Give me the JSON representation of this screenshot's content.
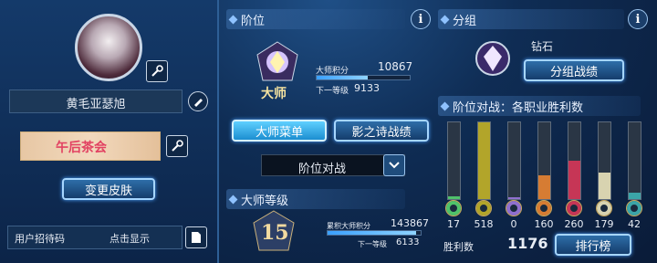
{
  "profile": {
    "name": "黄毛亚瑟旭",
    "change_skin": "变更皮肤",
    "invite_label": "用户招待码",
    "invite_action": "点击显示",
    "banner_text": "午后茶会"
  },
  "rank": {
    "header": "阶位",
    "rank_name": "大师",
    "points_label": "大师积分",
    "points": "10867",
    "next_label": "下一等级",
    "next_value": "9133",
    "progress": 0.55,
    "btn_master": "大师菜单",
    "btn_shadow": "影之诗战绩",
    "dropdown": "阶位对战"
  },
  "master_level": {
    "header": "大师等级",
    "level": "15",
    "points_label": "累积大师积分",
    "points": "143867",
    "next_label": "下一等级",
    "next_value": "6133",
    "progress": 0.95
  },
  "group": {
    "header": "分组",
    "name": "钻石",
    "btn": "分组战绩"
  },
  "class_wins": {
    "header": "阶位对战：各职业胜利数",
    "counts": [
      "17",
      "518",
      "0",
      "160",
      "260",
      "179",
      "42"
    ],
    "fills": [
      0.03,
      1.0,
      0.0,
      0.31,
      0.5,
      0.35,
      0.08
    ],
    "colors": [
      "#4fc26a",
      "#b2a52a",
      "#8f6fcf",
      "#d67c33",
      "#c63656",
      "#d8d3b0",
      "#3ba5a8"
    ],
    "icons": [
      "forest-icon",
      "sword-icon",
      "rune-icon",
      "dragon-icon",
      "blood-icon",
      "haven-icon",
      "portal-icon"
    ],
    "total_label": "胜利数",
    "total": "1176",
    "ranking_btn": "排行榜"
  }
}
